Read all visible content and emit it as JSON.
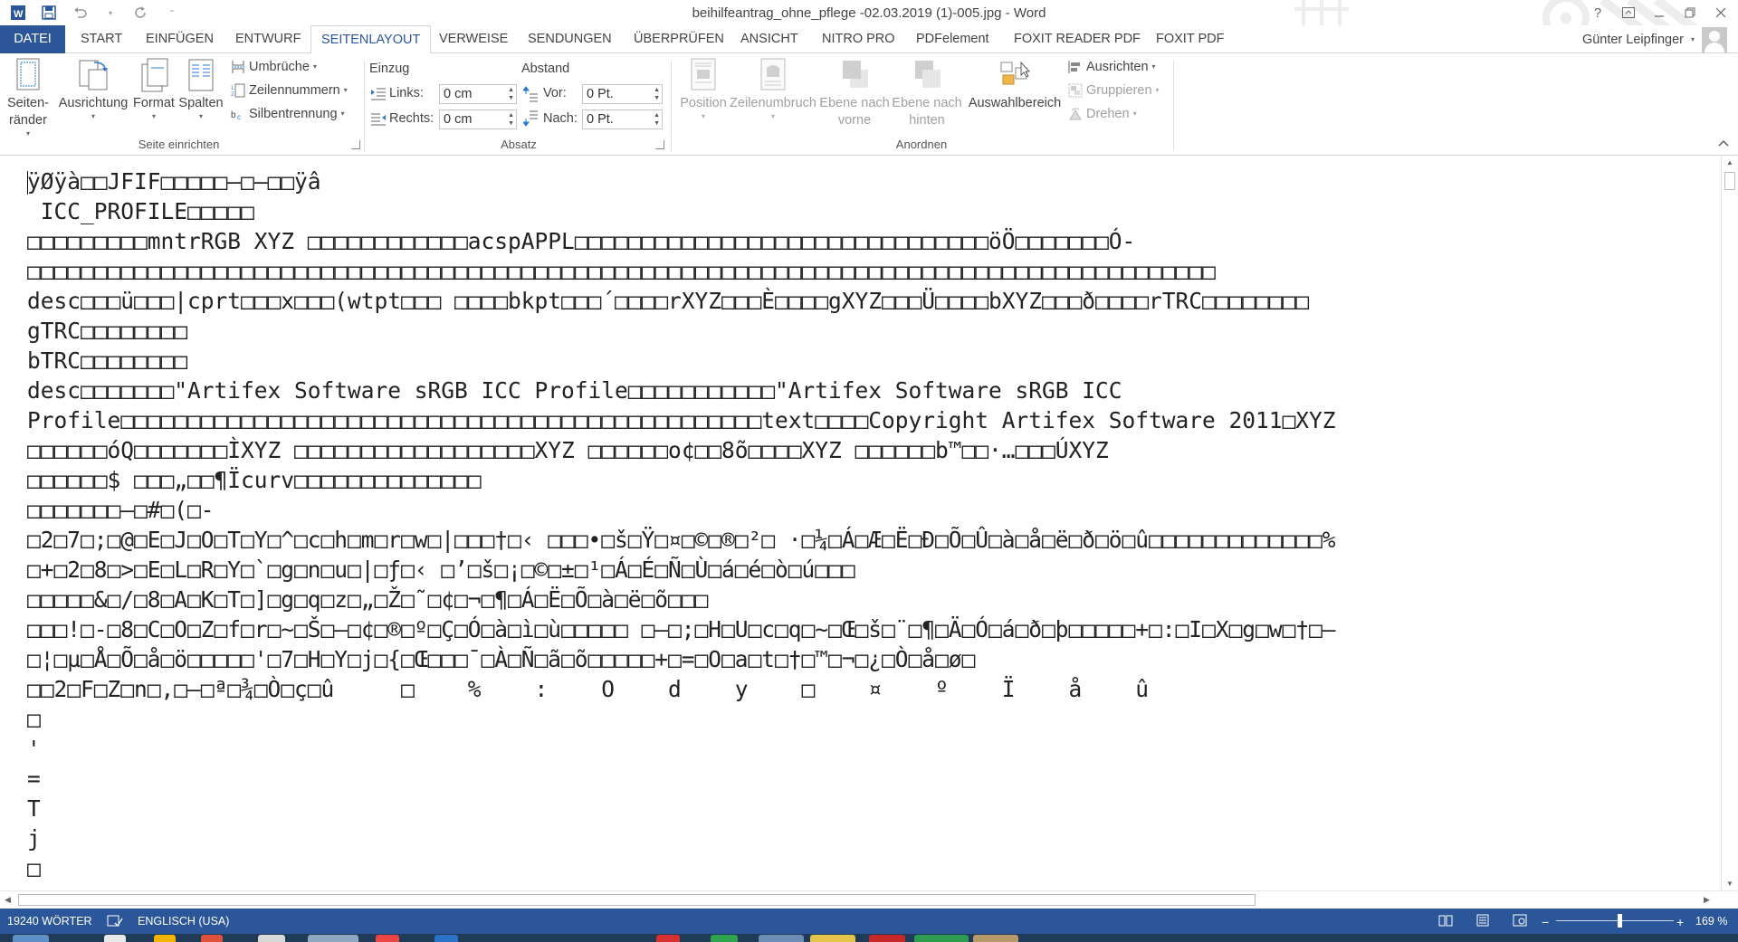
{
  "window": {
    "title": "beihilfeantrag_ohne_pflege -02.03.2019 (1)-005.jpg - Word",
    "controls": [
      "?",
      "restore-ribbon",
      "minimize",
      "maximize",
      "close"
    ]
  },
  "tabs": [
    {
      "label": "DATEI",
      "type": "file"
    },
    {
      "label": "START"
    },
    {
      "label": "EINFÜGEN"
    },
    {
      "label": "ENTWURF"
    },
    {
      "label": "SEITENLAYOUT",
      "active": true
    },
    {
      "label": "VERWEISE"
    },
    {
      "label": "SENDUNGEN"
    },
    {
      "label": "ÜBERPRÜFEN"
    },
    {
      "label": "ANSICHT"
    },
    {
      "label": "NITRO PRO"
    },
    {
      "label": "PDFelement"
    },
    {
      "label": "FOXIT READER PDF"
    },
    {
      "label": "FOXIT PDF"
    }
  ],
  "user": {
    "name": "Günter Leipfinger"
  },
  "ribbon": {
    "seite_einrichten": {
      "label": "Seite einrichten",
      "seitenraender_1": "Seiten-",
      "seitenraender_2": "ränder",
      "ausrichtung": "Ausrichtung",
      "format": "Format",
      "spalten": "Spalten",
      "umbrueche": "Umbrüche",
      "zeilennummern": "Zeilennummern",
      "silbentrennung": "Silbentrennung"
    },
    "absatz": {
      "label": "Absatz",
      "einzug": "Einzug",
      "abstand": "Abstand",
      "links_label": "Links:",
      "links_value": "0 cm",
      "rechts_label": "Rechts:",
      "rechts_value": "0 cm",
      "vor_label": "Vor:",
      "vor_value": "0 Pt.",
      "nach_label": "Nach:",
      "nach_value": "0 Pt."
    },
    "anordnen": {
      "label": "Anordnen",
      "position": "Position",
      "zeilenumbruch": "Zeilenumbruch",
      "ebene_vorne_1": "Ebene nach",
      "ebene_vorne_2": "vorne",
      "ebene_hinten_1": "Ebene nach",
      "ebene_hinten_2": "hinten",
      "auswahlbereich": "Auswahlbereich",
      "ausrichten": "Ausrichten",
      "gruppieren": "Gruppieren",
      "drehen": "Drehen"
    }
  },
  "document": {
    "lines": [
      "ÿØÿà□□JFIF□□□□□–□–□□ÿâ",
      " ICC_PROFILE□□□□□",
      "□□□□□□□□□mntrRGB XYZ □□□□□□□□□□□□acspAPPL□□□□□□□□□□□□□□□□□□□□□□□□□□□□□□□öÖ□□□□□□□Ó-",
      "□□□□□□□□□□□□□□□□□□□□□□□□□□□□□□□□□□□□□□□□□□□□□□□□□□□□□□□□□□□□□□□□□□□□□□□□□□□□□□□□□□□□□□□□□",
      "desc□□□ü□□□|cprt□□□x□□□(wtpt□□□ □□□□bkpt□□□´□□□□rXYZ□□□È□□□□gXYZ□□□Ü□□□□bXYZ□□□ð□□□□rTRC□□□□□□□□",
      "gTRC□□□□□□□□",
      "bTRC□□□□□□□□",
      "desc□□□□□□□\"Artifex Software sRGB ICC Profile□□□□□□□□□□□\"Artifex Software sRGB ICC",
      "Profile□□□□□□□□□□□□□□□□□□□□□□□□□□□□□□□□□□□□□□□□□□□□□□□□text□□□□Copyright Artifex Software 2011□XYZ",
      "□□□□□□óQ□□□□□□□ÌXYZ □□□□□□□□□□□□□□□□□□XYZ □□□□□□o¢□□8õ□□□□XYZ □□□□□□b™□□·…□□□ÚXYZ",
      "□□□□□□$ □□□„□□¶Ïcurv□□□□□□□□□□□□□□",
      "□□□□□□□–□#□(□-",
      "□2□7□;□@□E□J□O□T□Y□^□c□h□m□r□w□|□□□†□‹ □□□•□š□Ÿ□¤□©□®□²□ ·□¼□Á□Æ□Ë□Ð□Õ□Û□à□å□ë□ð□ö□û□□□□□□□□□□□□□%",
      "□+□2□8□>□E□L□R□Y□`□g□n□u□|□ƒ□‹ □’□š□¡□©□±□¹□Á□É□Ñ□Ù□á□é□ò□ú□□□",
      "□□□□□&□/□8□A□K□T□]□g□q□z□„□Ž□˜□¢□¬□¶□Á□Ë□Õ□à□ë□õ□□□",
      "□□□!□-□8□C□O□Z□f□r□~□Š□–□¢□®□º□Ç□Ó□à□ì□ù□□□□□ □–□;□H□U□c□q□~□Œ□š□¨□¶□Ä□Ó□á□ð□þ□□□□□+□:□I□X□g□w□†□–",
      "□¦□µ□Å□Õ□å□ö□□□□□'□7□H□Y□j□{□Œ□□□¯□À□Ñ□ã□õ□□□□□+□=□O□a□t□†□™□¬□¿□Ò□å□ø□",
      "□□2□F□Z□n□,□–□ª□¾□Ò□ç□û     □    %    :    O    d    y    □    ¤    º    Ï    å    û",
      "□",
      "'",
      "=",
      "T",
      "j",
      "□"
    ]
  },
  "status": {
    "words": "19240 WÖRTER",
    "language": "ENGLISCH (USA)",
    "zoom": "169 %",
    "zoom_minus": "−",
    "zoom_plus": "+"
  }
}
